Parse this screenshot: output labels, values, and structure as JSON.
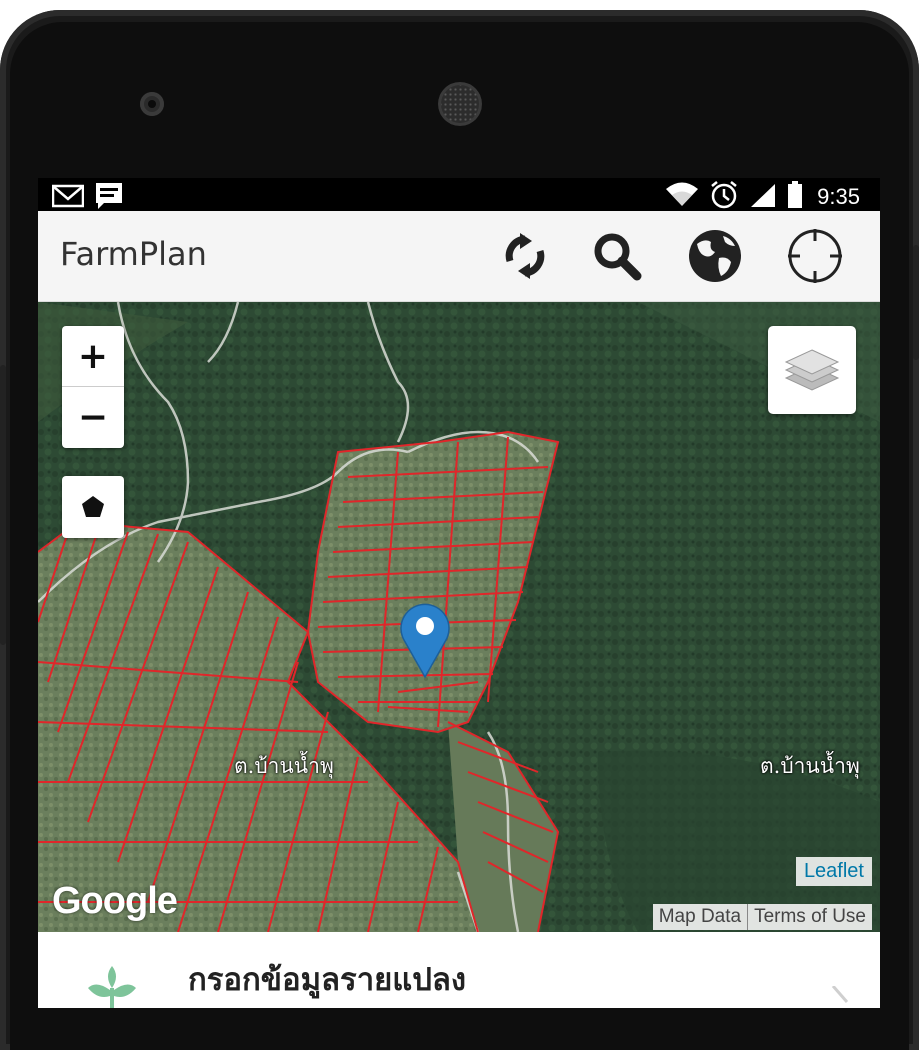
{
  "status_bar": {
    "left_icons": [
      "gmail-icon",
      "message-icon"
    ],
    "right_icons": [
      "wifi-icon",
      "alarm-icon",
      "signal-icon",
      "battery-icon"
    ],
    "time": "9:35"
  },
  "app_bar": {
    "title": "FarmPlan",
    "actions": [
      "refresh-icon",
      "search-icon",
      "globe-icon",
      "locate-icon"
    ]
  },
  "map": {
    "zoom_in": "+",
    "zoom_out": "−",
    "labels": [
      "ต.บ้านน้ำพุ",
      "ต.บ้านน้ำพุ"
    ],
    "google": "Google",
    "leaflet": "Leaflet",
    "attribution": [
      "Map Data",
      "Terms of Use"
    ],
    "colors": {
      "parcel_line": "#e0262a",
      "marker": "#2a81cb"
    }
  },
  "bottom_sheet": {
    "title": "กรอกข้อมูลรายแปลง"
  }
}
